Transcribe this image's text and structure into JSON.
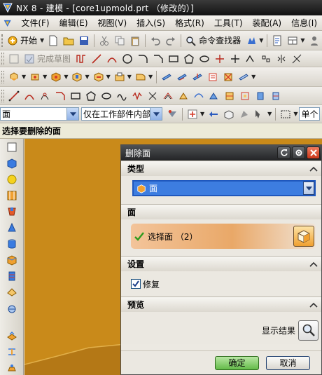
{
  "window": {
    "title": "NX 8 - 建模 - [core1upmold.prt （修改的）]"
  },
  "menu": {
    "items": [
      "文件(F)",
      "编辑(E)",
      "视图(V)",
      "插入(S)",
      "格式(R)",
      "工具(T)",
      "装配(A)",
      "信息(I)"
    ]
  },
  "toolbar": {
    "start_label": "开始",
    "finish_sketch_label": "完成草图",
    "command_finder_label": "命令查找器"
  },
  "selection_bar": {
    "filter_value": "面",
    "scope_value": "仅在工作部件内部",
    "trailing_value": "单个"
  },
  "cue_line": {
    "prompt": "选择要删除的面"
  },
  "dialog": {
    "title": "删除面",
    "sections": {
      "type": "类型",
      "face": "面",
      "settings": "设置",
      "preview": "预览"
    },
    "type_value": "面",
    "select_face_label": "选择面 （2）",
    "repair_label": "修复",
    "repair_checked": true,
    "show_result_label": "显示结果",
    "ok_label": "确定",
    "cancel_label": "取消"
  },
  "icons": {
    "left_resource_bar": [
      "box-select-icon",
      "block-icon",
      "sphere-icon",
      "assembly-navigator-icon",
      "palette-icon",
      "cone-icon",
      "cylinder-icon",
      "reuse-library-icon",
      "history-icon",
      "roles-icon",
      "web-icon",
      "process-studio-icon",
      "constraint-icon",
      "system-materials-icon"
    ]
  },
  "colors": {
    "graphics_background": "#c98a1a",
    "active_type_highlight": "#3d7de0",
    "ok_button": "#64bb4a",
    "title_bar": "#121212"
  }
}
